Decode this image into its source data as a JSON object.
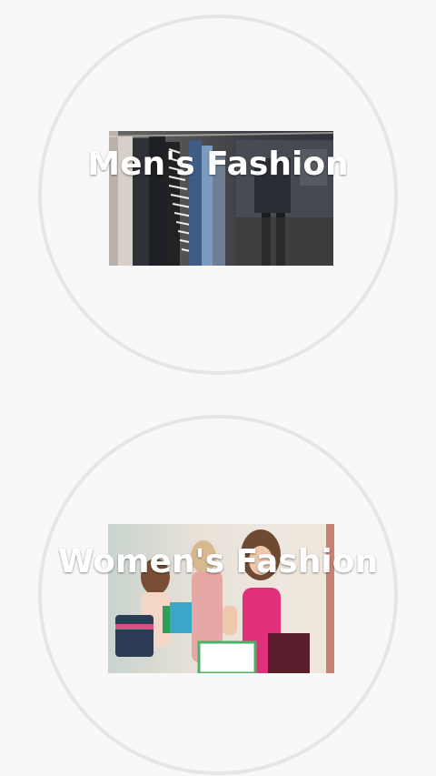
{
  "categories": [
    {
      "label": "Men's Fashion",
      "image_icon": "clothing-rack-photo"
    },
    {
      "label": "Women's Fashion",
      "image_icon": "shopping-women-photo"
    }
  ],
  "colors": {
    "background": "#f8f8f8",
    "circle_border": "#e6e6e6",
    "label_text": "#ffffff"
  }
}
